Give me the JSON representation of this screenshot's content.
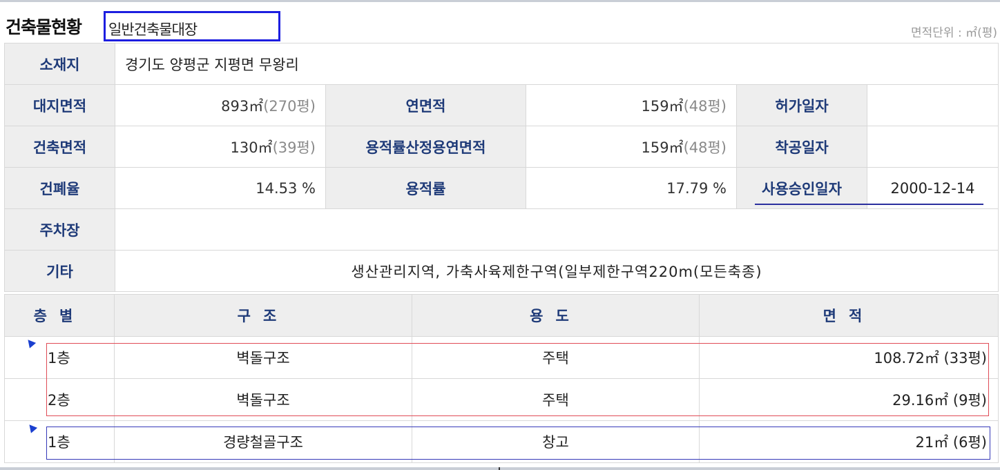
{
  "header": {
    "title": "건축물현황",
    "register_type": "일반건축물대장",
    "area_unit": "면적단위 : ㎡(평)"
  },
  "summary": {
    "location_label": "소재지",
    "location_value": "경기도 양평군 지평면 무왕리",
    "site_area_label": "대지면적",
    "site_area_m2": "893㎡",
    "site_area_py": "(270평)",
    "total_floor_area_label": "연면적",
    "total_floor_area_m2": "159㎡",
    "total_floor_area_py": "(48평)",
    "permit_date_label": "허가일자",
    "permit_date_value": "",
    "building_area_label": "건축면적",
    "building_area_m2": "130㎡",
    "building_area_py": "(39평)",
    "far_floor_area_label": "용적률산정용연면적",
    "far_floor_area_m2": "159㎡",
    "far_floor_area_py": "(48평)",
    "start_date_label": "착공일자",
    "start_date_value": "",
    "bcr_label": "건폐율",
    "bcr_value": "14.53 %",
    "far_label": "용적률",
    "far_value": "17.79 %",
    "approval_date_label": "사용승인일자",
    "approval_date_value": "2000-12-14",
    "parking_label": "주차장",
    "parking_value": "",
    "other_label": "기타",
    "other_value": "생산관리지역,  가축사육제한구역(일부제한구역220m(모든축종)"
  },
  "floors": {
    "headers": [
      "층별",
      "구조",
      "용도",
      "면적"
    ],
    "rows": [
      {
        "floor": "1층",
        "structure": "벽돌구조",
        "use": "주택",
        "area": "108.72㎡ (33평)"
      },
      {
        "floor": "2층",
        "structure": "벽돌구조",
        "use": "주택",
        "area": "29.16㎡ (9평)"
      },
      {
        "floor": "1층",
        "structure": "경량철골구조",
        "use": "창고",
        "area": "21㎡ (6평)"
      }
    ]
  },
  "colors": {
    "header_bg": "#eeeeee",
    "label_text": "#1e3a78",
    "accent_blue": "#1c1ee0",
    "highlight_red": "#e04b56"
  }
}
